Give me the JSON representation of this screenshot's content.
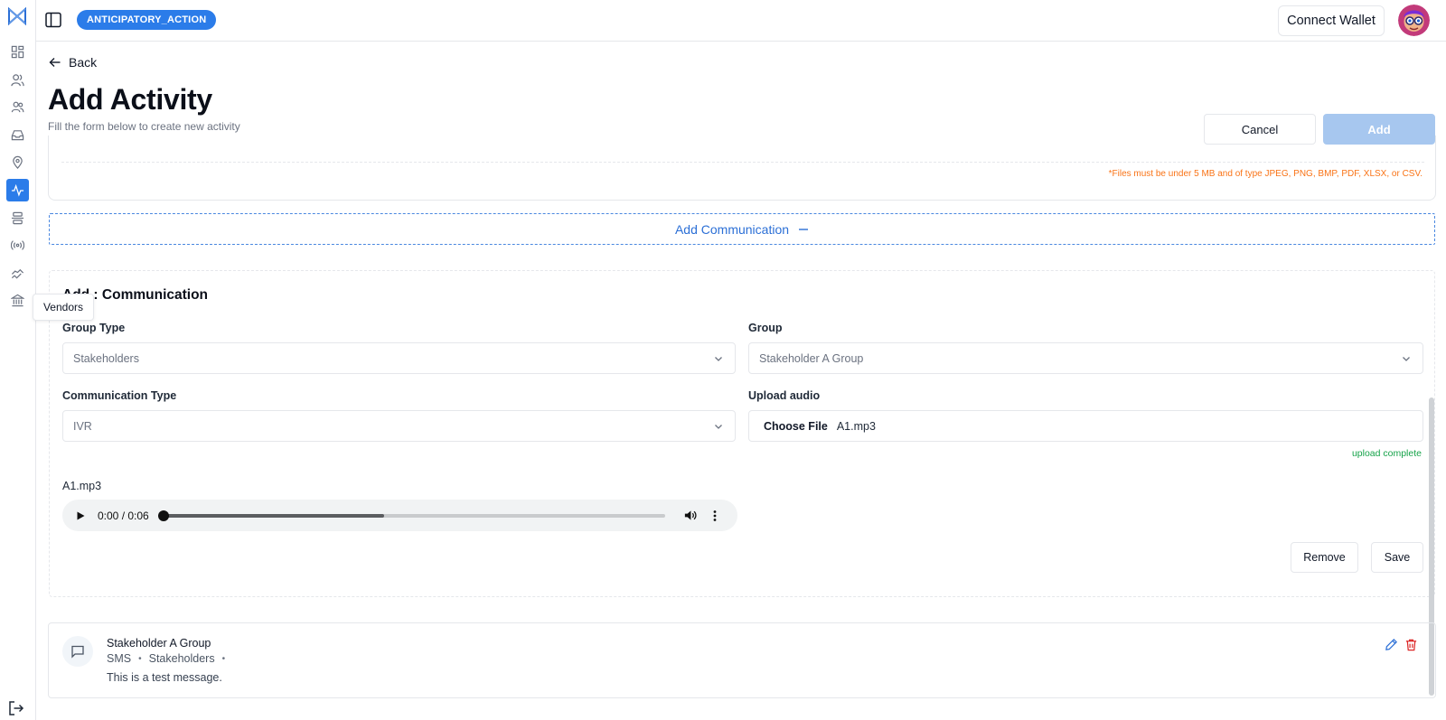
{
  "topbar": {
    "project_badge": "ANTICIPATORY_ACTION",
    "connect_wallet_label": "Connect Wallet"
  },
  "sidebar": {
    "items": [
      {
        "icon": "dashboard-icon"
      },
      {
        "icon": "users-icon"
      },
      {
        "icon": "group-icon"
      },
      {
        "icon": "inbox-icon"
      },
      {
        "icon": "location-pin-icon"
      },
      {
        "icon": "activity-icon",
        "active": true
      },
      {
        "icon": "layers-icon"
      },
      {
        "icon": "broadcast-icon"
      },
      {
        "icon": "handshake-icon"
      },
      {
        "icon": "bank-icon"
      }
    ],
    "tooltip": "Vendors",
    "accent_color": "#2b7ce9"
  },
  "header": {
    "back_label": "Back",
    "title": "Add Activity",
    "subtitle": "Fill the form below to create new activity",
    "cancel_label": "Cancel",
    "add_label": "Add"
  },
  "previous_section": {
    "file_note": "*Files must be under 5 MB and of type JPEG, PNG, BMP, PDF, XLSX, or CSV."
  },
  "add_communication": {
    "label": "Add Communication",
    "icon": "minus-icon"
  },
  "communication_form": {
    "title": "Add : Communication",
    "group_type": {
      "label": "Group Type",
      "value": "Stakeholders"
    },
    "group": {
      "label": "Group",
      "value": "Stakeholder A Group"
    },
    "communication_type": {
      "label": "Communication Type",
      "value": "IVR"
    },
    "upload_audio": {
      "label": "Upload audio",
      "button": "Choose File",
      "file_name": "A1.mp3",
      "status": "upload complete"
    },
    "audio": {
      "name": "A1.mp3",
      "time": "0:00 / 0:06",
      "position_fraction": 0.0,
      "buffered_fraction": 0.44
    },
    "remove_label": "Remove",
    "save_label": "Save"
  },
  "communications_list": [
    {
      "group": "Stakeholder A Group",
      "type": "SMS",
      "group_type": "Stakeholders",
      "message": "This is a test message."
    }
  ]
}
